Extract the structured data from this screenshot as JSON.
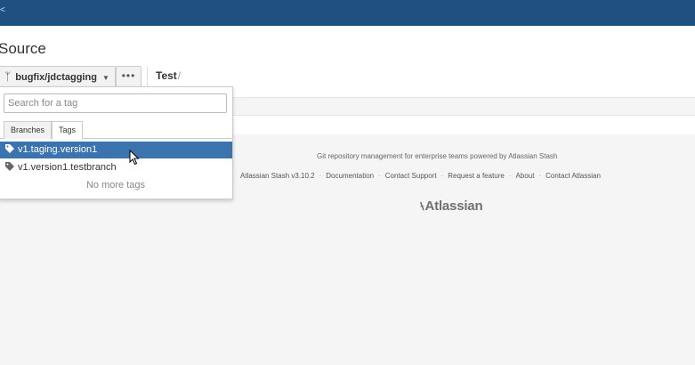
{
  "header": {
    "edge_glyph": "<"
  },
  "page": {
    "title": "Source",
    "branch_selector": {
      "label": "bugfix/jdctagging",
      "icon": "branch-icon"
    },
    "more_button": "•••",
    "breadcrumb": {
      "repo": "Test",
      "separator": "/"
    }
  },
  "dropdown": {
    "search_placeholder": "Search for a tag",
    "search_value": "",
    "tabs": [
      {
        "label": "Branches",
        "selected": false
      },
      {
        "label": "Tags",
        "selected": true
      }
    ],
    "tags": [
      {
        "name": "v1.taging.version1",
        "selected": true
      },
      {
        "name": "v1.version1.testbranch",
        "selected": false
      }
    ],
    "no_more_text": "No more tags"
  },
  "footer": {
    "tagline": "Git repository management for enterprise teams powered by Atlassian Stash",
    "links": [
      "Atlassian Stash v3.10.2",
      "Documentation",
      "Contact Support",
      "Request a feature",
      "About",
      "Contact Atlassian"
    ],
    "logo_text": "Atlassian"
  },
  "colors": {
    "topbar": "#205081",
    "selected_row": "#3b73af"
  }
}
